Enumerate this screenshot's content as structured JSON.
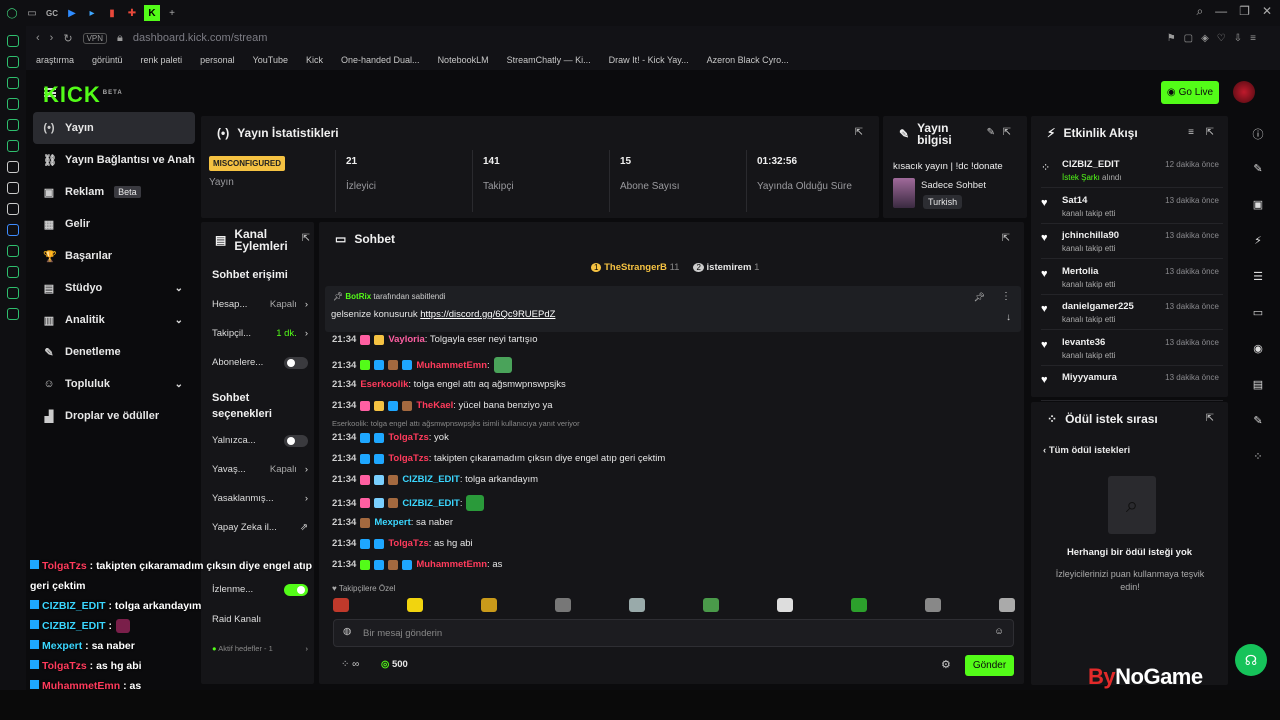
{
  "browser": {
    "tabs": [
      "GC"
    ],
    "url": "dashboard.kick.com/stream",
    "vpn": "VPN",
    "bookmarks": [
      "araştırma",
      "görüntü",
      "renk paleti",
      "personal",
      "YouTube",
      "Kick",
      "One-handed Dual...",
      "NotebookLM",
      "StreamChatly — Ki...",
      "Draw It! - Kick Yay...",
      "Azeron Black Cyro..."
    ]
  },
  "header": {
    "logo": "KICK",
    "logo_sup": "BETA",
    "go_live": "Go Live"
  },
  "nav": {
    "items": [
      {
        "label": "Yayın",
        "icon": "(•)"
      },
      {
        "label": "Yayın Bağlantısı ve Anahtarı",
        "icon": "⛓"
      },
      {
        "label": "Reklam",
        "icon": "▣",
        "badge": "Beta"
      },
      {
        "label": "Gelir",
        "icon": "▦"
      },
      {
        "label": "Başarılar",
        "icon": "🏆"
      },
      {
        "label": "Stüdyo",
        "icon": "▤"
      },
      {
        "label": "Analitik",
        "icon": "▥"
      },
      {
        "label": "Denetleme",
        "icon": "✎"
      },
      {
        "label": "Topluluk",
        "icon": "☺"
      },
      {
        "label": "Droplar ve ödüller",
        "icon": "▟"
      }
    ]
  },
  "stats": {
    "title": "Yayın İstatistikleri",
    "status_badge": "MISCONFIGURED",
    "items": [
      {
        "value": "",
        "label": "Yayın"
      },
      {
        "value": "21",
        "label": "İzleyici"
      },
      {
        "value": "141",
        "label": "Takipçi"
      },
      {
        "value": "15",
        "label": "Abone Sayısı"
      },
      {
        "value": "01:32:56",
        "label": "Yayında Olduğu Süre"
      }
    ]
  },
  "info": {
    "title": "Yayın bilgisi",
    "stream_title": "kısacık yayın | !dc !donate",
    "category": "Sadece Sohbet",
    "tag": "Turkish"
  },
  "events": {
    "title": "Etkinlik Akışı",
    "items": [
      {
        "name": "CIZBIZ_EDIT",
        "action_hl": "İstek Şarkı",
        "action": "alındı",
        "time": "12 dakika önce"
      },
      {
        "name": "Sat14",
        "action": "kanalı takip etti",
        "time": "13 dakika önce"
      },
      {
        "name": "jchinchilla90",
        "action": "kanalı takip etti",
        "time": "13 dakika önce"
      },
      {
        "name": "Mertolia",
        "action": "kanalı takip etti",
        "time": "13 dakika önce"
      },
      {
        "name": "danielgamer225",
        "action": "kanalı takip etti",
        "time": "13 dakika önce"
      },
      {
        "name": "levante36",
        "action": "kanalı takip etti",
        "time": "13 dakika önce"
      },
      {
        "name": "Miyyyamura",
        "action": "",
        "time": "13 dakika önce"
      }
    ]
  },
  "rewards": {
    "title": "Ödül istek sırası",
    "back": "Tüm ödül istekleri",
    "empty_title": "Herhangi bir ödül isteği yok",
    "empty_text": "İzleyicilerinizi puan kullanmaya teşvik edin!"
  },
  "kanal": {
    "title": "Kanal Eylemleri",
    "section1": "Sohbet erişimi",
    "rows1": [
      {
        "label": "Hesap...",
        "value": "Kapalı",
        "kind": "chev"
      },
      {
        "label": "Takipçil...",
        "value": "1 dk.",
        "kind": "chev"
      },
      {
        "label": "Abonelere...",
        "value": "",
        "kind": "toggle"
      }
    ],
    "section2": "Sohbet seçenekleri",
    "rows2": [
      {
        "label": "Yalnızca...",
        "value": "",
        "kind": "toggle"
      },
      {
        "label": "Yavaş...",
        "value": "Kapalı",
        "kind": "chev"
      },
      {
        "label": "Yasaklanmış...",
        "value": "",
        "kind": "chev"
      },
      {
        "label": "Yapay Zeka il...",
        "value": "",
        "kind": "ext"
      }
    ],
    "watch": "İzlenme...",
    "raid": "Raid Kanalı",
    "active": "Aktif hedefler - 1"
  },
  "chat": {
    "title": "Sohbet",
    "top_users": [
      {
        "name": "TheStrangerB",
        "count": "11",
        "rank": "1"
      },
      {
        "name": "istemirem",
        "count": "1",
        "rank": "2"
      }
    ],
    "pinned_by": "BotRix",
    "pinned_suffix": "tarafından sabitlendi",
    "pinned_text": "gelsenize konusuruk",
    "pinned_link": "https://discord.gg/6Qc9RUEPdZ",
    "reply_note": "Eserkoolik: tolga engel attı ağsmwpnswpsjks isimli kullanıcıya yanıt veriyor",
    "messages": [
      {
        "time": "21:34",
        "user": "Vayloria",
        "color": "#ff5fa2",
        "text": ": Tolgayla eser neyi tartışıo"
      },
      {
        "time": "21:34",
        "user": "MuhammetEmn",
        "color": "#ff3b5c",
        "text": ":"
      },
      {
        "time": "21:34",
        "user": "Eserkoolik",
        "color": "#ff3b5c",
        "text": ": tolga engel attı aq ağsmwpnswpsjks"
      },
      {
        "time": "21:34",
        "user": "TheKael",
        "color": "#ff3b5c",
        "text": ": yücel bana benziyo ya"
      },
      {
        "time": "21:34",
        "user": "TolgaTzs",
        "color": "#ff3b5c",
        "text": ": yok"
      },
      {
        "time": "21:34",
        "user": "TolgaTzs",
        "color": "#ff3b5c",
        "text": ": takipten çıkaramadım çıksın diye engel atıp geri çektim"
      },
      {
        "time": "21:34",
        "user": "CIZBIZ_EDIT",
        "color": "#3bd7ff",
        "text": ": tolga arkandayım"
      },
      {
        "time": "21:34",
        "user": "CIZBIZ_EDIT",
        "color": "#3bd7ff",
        "text": ":"
      },
      {
        "time": "21:34",
        "user": "Mexpert",
        "color": "#3bd7ff",
        "text": ": sa naber"
      },
      {
        "time": "21:34",
        "user": "TolgaTzs",
        "color": "#ff3b5c",
        "text": ": as hg abi"
      },
      {
        "time": "21:34",
        "user": "MuhammetEmn",
        "color": "#ff3b5c",
        "text": ": as"
      }
    ],
    "followers_only": "Takipçilere Özel",
    "placeholder": "Bir mesaj gönderin",
    "points": "500",
    "send": "Gönder"
  },
  "overlay": {
    "lines": [
      {
        "user": "TolgaTzs",
        "color": "#ff3b5c",
        "text": " : takipten çıkaramadım çıksın diye engel atıp geri çektim"
      },
      {
        "user": "CIZBIZ_EDIT",
        "color": "#3bd7ff",
        "text": " : tolga arkandayım"
      },
      {
        "user": "CIZBIZ_EDIT",
        "color": "#3bd7ff",
        "text": " :"
      },
      {
        "user": "Mexpert",
        "color": "#3bd7ff",
        "text": " : sa naber"
      },
      {
        "user": "TolgaTzs",
        "color": "#ff3b5c",
        "text": " : as hg abi"
      },
      {
        "user": "MuhammetEmn",
        "color": "#ff3b5c",
        "text": " : as"
      }
    ]
  },
  "watermark": {
    "by": "By",
    "no": "No",
    "game": "Game"
  },
  "colors": {
    "accent": "#53fc18",
    "panel": "#151518",
    "bg": "#0b0b0d"
  }
}
